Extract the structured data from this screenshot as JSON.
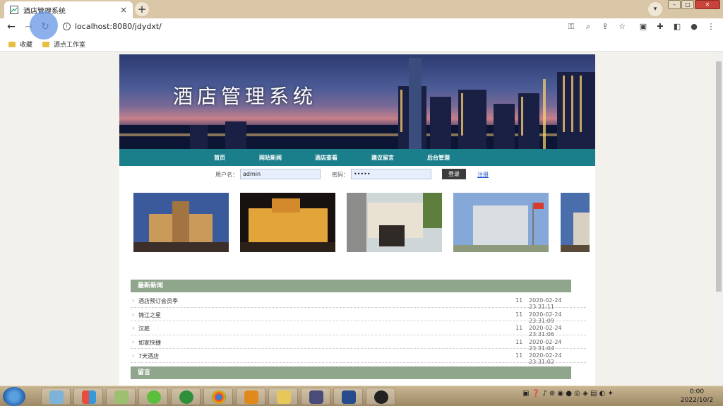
{
  "browser": {
    "tab_title": "酒店管理系统",
    "tab_close": "×",
    "new_tab": "+",
    "url": "localhost:8080/jdydxt/",
    "bookmarks": [
      "收藏",
      "源点工作室"
    ],
    "icons": [
      "back-icon",
      "forward-icon",
      "reload-icon",
      "info-icon",
      "key-icon",
      "zoom-icon",
      "share-icon",
      "star-icon",
      "extension-icon",
      "puzzle-icon",
      "sidebar-icon",
      "profile-icon",
      "menu-icon"
    ]
  },
  "site": {
    "banner_title": "酒店管理系统",
    "nav": [
      "首页",
      "网站新闻",
      "酒店查看",
      "建议留言",
      "后台管理"
    ],
    "login": {
      "username_label": "用户名：",
      "username_value": "admin",
      "password_label": "密码：",
      "password_value": "•••••",
      "login_button": "登录",
      "register_link": "注册"
    },
    "sections": {
      "news_title": "最新新闻",
      "message_title": "留言"
    },
    "news": [
      {
        "title": "酒店预订会员季",
        "count": "11",
        "date": "2020-02-24 23:31:11"
      },
      {
        "title": "锦江之星",
        "count": "11",
        "date": "2020-02-24 23:31:09"
      },
      {
        "title": "汉庭",
        "count": "11",
        "date": "2020-02-24 23:31:06"
      },
      {
        "title": "如家快捷",
        "count": "11",
        "date": "2020-02-24 23:31:04"
      },
      {
        "title": "7天酒店",
        "count": "11",
        "date": "2020-02-24 23:31:02"
      }
    ]
  },
  "taskbar": {
    "clock_time": "0:00",
    "clock_date": "2022/10/2"
  },
  "colors": {
    "nav_bar": "#1b7f8b",
    "section_header": "#8fa58c",
    "link": "#1a56c8"
  }
}
